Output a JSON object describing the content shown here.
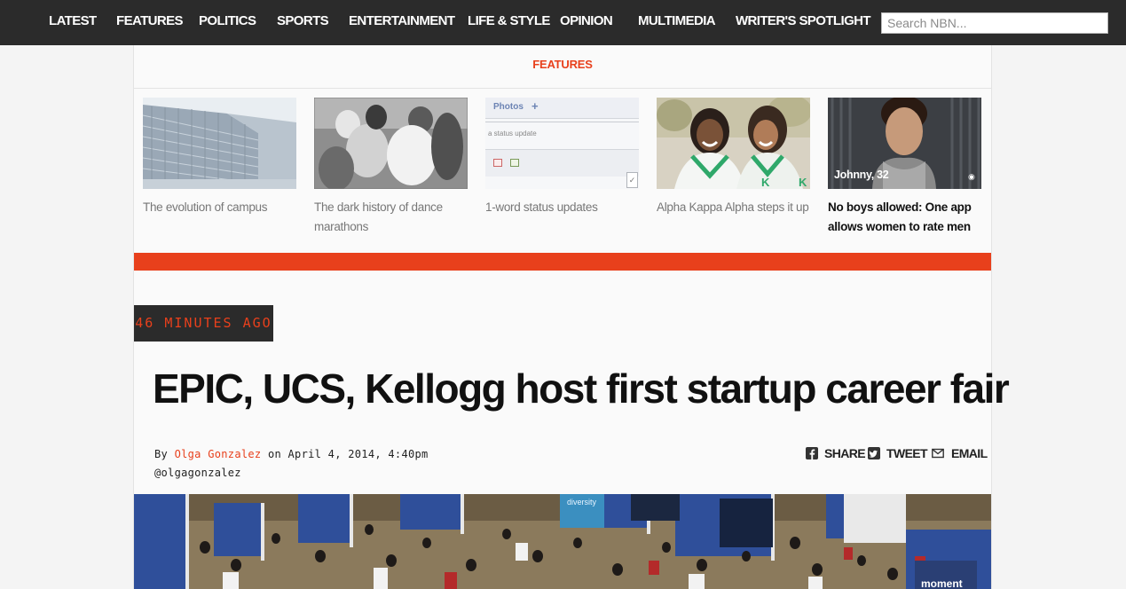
{
  "nav": {
    "items": [
      "LATEST",
      "FEATURES",
      "POLITICS",
      "SPORTS",
      "ENTERTAINMENT",
      "LIFE & STYLE",
      "OPINION",
      "MULTIMEDIA",
      "WRITER'S SPOTLIGHT"
    ],
    "search_placeholder": "Search NBN..."
  },
  "features": {
    "heading": "FEATURES",
    "cards": [
      {
        "caption": "The evolution of campus"
      },
      {
        "caption": "The dark history of dance marathons"
      },
      {
        "caption": "1-word status updates",
        "thumb_text_1": "Photos",
        "thumb_text_2": "a status update"
      },
      {
        "caption": "Alpha Kappa Alpha steps it up"
      },
      {
        "caption": "No boys allowed: One app allows women to rate men",
        "thumb_overlay": "Johnny, 32"
      }
    ]
  },
  "article": {
    "time_ago": "46 MINUTES AGO",
    "title": "EPIC, UCS, Kellogg host first startup career fair",
    "by": "By",
    "author": "Olga Gonzalez",
    "date": "on April 4, 2014, 4:40pm",
    "handle": "@olgagonzalez",
    "share_label": "SHARE",
    "tweet_label": "TWEET",
    "email_label": "EMAIL",
    "hero_sign_1": "diversity",
    "hero_sign_2": "moment"
  },
  "colors": {
    "accent": "#e8401c",
    "nav_bg": "#2b2b2b",
    "page_bg": "#f4f4f4"
  }
}
